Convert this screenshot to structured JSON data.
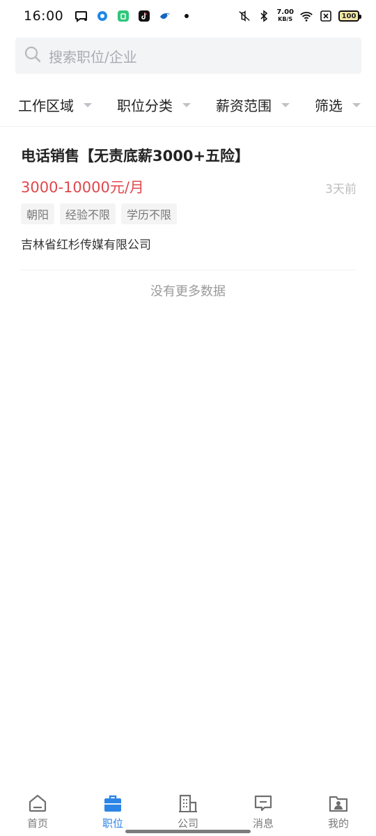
{
  "status_bar": {
    "time": "16:00",
    "net_speed_value": "7.00",
    "net_speed_unit": "KB/S",
    "battery": "100"
  },
  "search": {
    "placeholder": "搜索职位/企业"
  },
  "filters": [
    {
      "label": "工作区域"
    },
    {
      "label": "职位分类"
    },
    {
      "label": "薪资范围"
    },
    {
      "label": "筛选"
    }
  ],
  "jobs": [
    {
      "title": "电话销售【无责底薪3000+五险】",
      "salary": "3000-10000元/月",
      "posted": "3天前",
      "tags": [
        "朝阳",
        "经验不限",
        "学历不限"
      ],
      "company": "吉林省红杉传媒有限公司"
    }
  ],
  "list_end_text": "没有更多数据",
  "nav": {
    "items": [
      {
        "label": "首页",
        "icon": "home-icon"
      },
      {
        "label": "职位",
        "icon": "briefcase-icon"
      },
      {
        "label": "公司",
        "icon": "building-icon"
      },
      {
        "label": "消息",
        "icon": "message-icon"
      },
      {
        "label": "我的",
        "icon": "profile-icon"
      }
    ],
    "active_index": 1
  },
  "colors": {
    "accent": "#2b84e6",
    "salary": "#e0474c",
    "muted": "#a8abb2"
  }
}
